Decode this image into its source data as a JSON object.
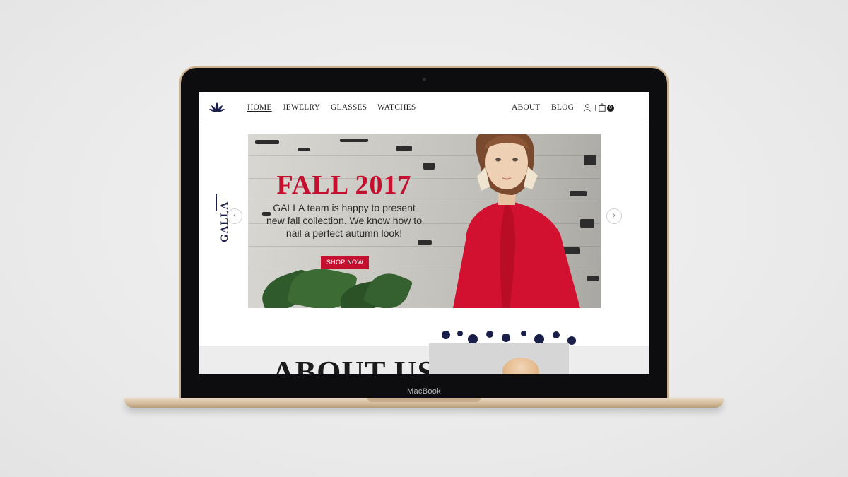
{
  "bezel": {
    "label": "MacBook"
  },
  "nav": {
    "left_links": [
      {
        "label": "HOME",
        "active": true
      },
      {
        "label": "JEWELRY",
        "active": false
      },
      {
        "label": "GLASSES",
        "active": false
      },
      {
        "label": "WATCHES",
        "active": false
      }
    ],
    "right_links": [
      {
        "label": "ABOUT"
      },
      {
        "label": "BLOG"
      }
    ],
    "cart_count": "0",
    "icons": [
      "lotus-logo-icon",
      "user-icon",
      "shopping-bag-icon"
    ]
  },
  "sidebar": {
    "brand": "GALLA"
  },
  "hero": {
    "title": "FALL 2017",
    "text": "GALLA team is happy to present new fall collection. We know how to nail a perfect autumn look!",
    "cta": "SHOP NOW",
    "prev_arrow": "‹",
    "next_arrow": "›"
  },
  "about": {
    "title": "ABOUT US"
  },
  "colors": {
    "accent": "#c4102e",
    "navy": "#1a1f4a",
    "text": "#1d1d1d",
    "laptop_gold": "#d3bb9b"
  }
}
